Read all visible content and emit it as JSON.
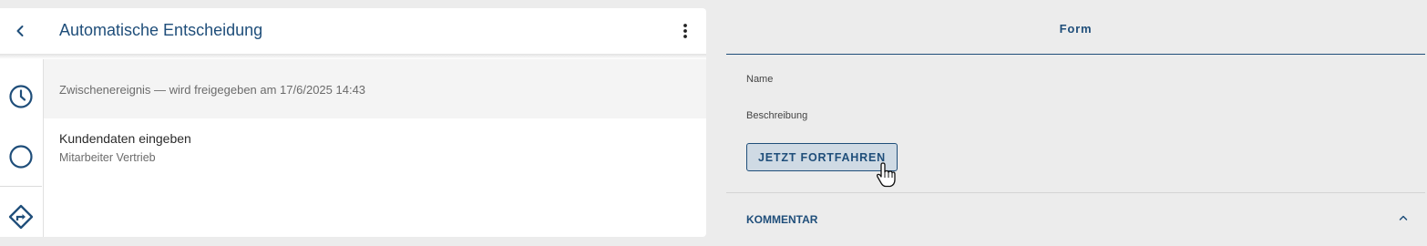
{
  "header": {
    "title": "Automatische Entscheidung"
  },
  "rail": {
    "icons": [
      "clock-icon",
      "circle-icon",
      "route-diamond-icon"
    ]
  },
  "events": {
    "intermediate": "Zwischenereignis — wird freigegeben am 17/6/2025 14:43",
    "task_title": "Kundendaten eingeben",
    "task_role": "Mitarbeiter Vertrieb"
  },
  "form": {
    "tab_label": "Form",
    "name_label": "Name",
    "description_label": "Beschreibung",
    "continue_button": "JETZT FORTFAHREN"
  },
  "comment": {
    "label": "KOMMENTAR"
  },
  "colors": {
    "accent": "#1f4e7a",
    "background": "#ececec",
    "button_bg": "#cfdae4"
  }
}
